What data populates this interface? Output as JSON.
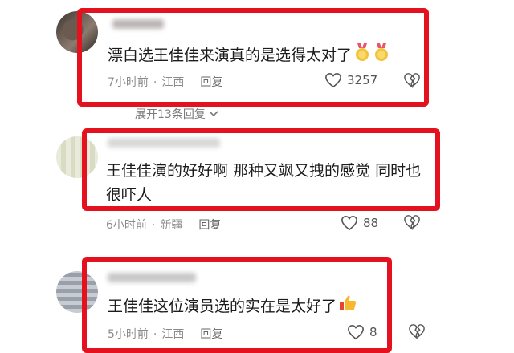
{
  "comments": [
    {
      "text": "漂白选王佳佳来演真的是选得太对了",
      "emoji": "medal-heart-icons",
      "time": "7小时前",
      "location": "江西",
      "reply": "回复",
      "likes": "3257"
    },
    {
      "text": "王佳佳演的好好啊 那种又飒又拽的感觉 同时也很吓人",
      "time": "6小时前",
      "location": "新疆",
      "reply": "回复",
      "likes": "88"
    },
    {
      "text": "王佳佳这位演员选的实在是太好了",
      "emoji": "thumbs-up-icon",
      "time": "5小时前",
      "location": "江西",
      "reply": "回复",
      "likes": "8"
    }
  ],
  "expand_replies": "展开13条回复",
  "separator": "·",
  "colors": {
    "highlight": "#e3121e",
    "meta": "#8a8a8a"
  }
}
